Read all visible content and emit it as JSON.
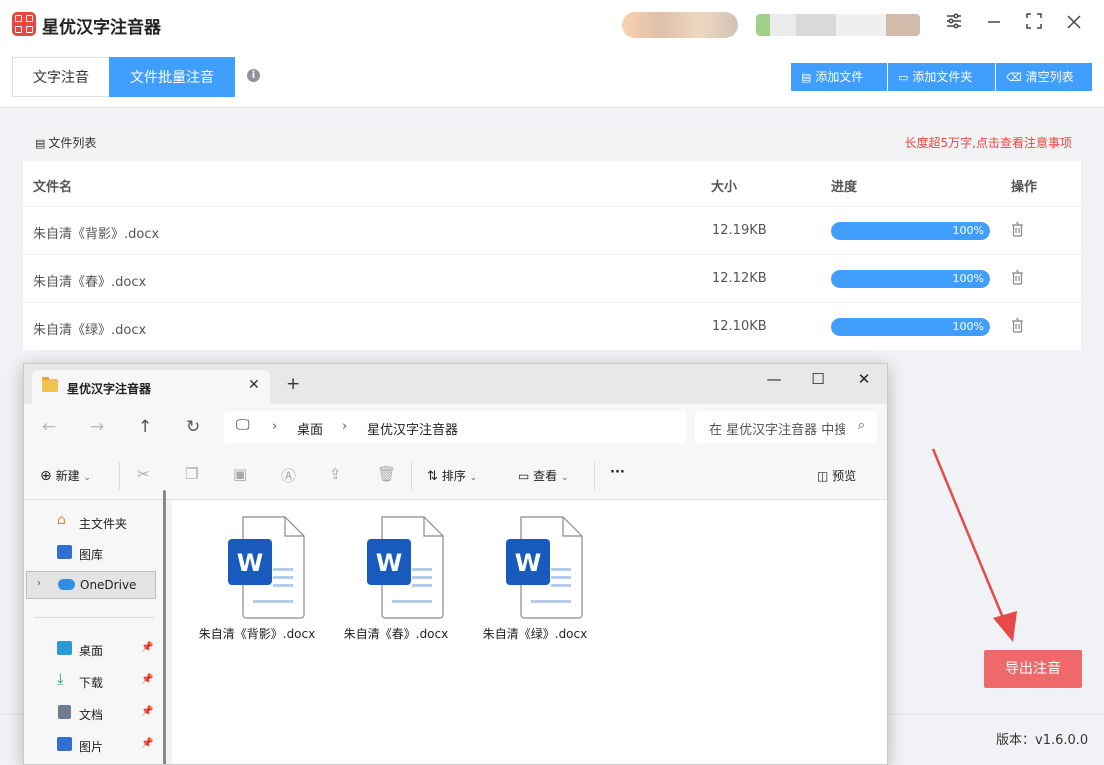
{
  "app": {
    "title": "星优汉字注音器",
    "version": "版本：v1.6.0.0",
    "accent": "#409eff",
    "export_color": "#f0696a"
  },
  "tabs": {
    "text_tab": "文字注音",
    "batch_tab": "文件批量注音"
  },
  "toolbar": {
    "add_file": "添加文件",
    "add_folder": "添加文件夹",
    "clear_list": "清空列表"
  },
  "file_list": {
    "title": "文件列表",
    "notice": "长度超5万字,点击查看注意事项",
    "headers": {
      "name": "文件名",
      "size": "大小",
      "progress": "进度",
      "action": "操作"
    },
    "rows": [
      {
        "name": "朱自清《背影》.docx",
        "size": "12.19KB",
        "progress": 1.0,
        "progress_label": "100%"
      },
      {
        "name": "朱自清《春》.docx",
        "size": "12.12KB",
        "progress": 1.0,
        "progress_label": "100%"
      },
      {
        "name": "朱自清《绿》.docx",
        "size": "12.10KB",
        "progress": 1.0,
        "progress_label": "100%"
      }
    ]
  },
  "export_button": "导出注音",
  "explorer": {
    "tab_title": "星优汉字注音器",
    "breadcrumb": [
      "桌面",
      "星优汉字注音器"
    ],
    "search_placeholder": "在 星优汉字注音器 中搜索",
    "toolbar": {
      "new": "新建",
      "sort": "排序",
      "view": "查看",
      "more": "···",
      "preview": "预览"
    },
    "sidebar": [
      {
        "label": "主文件夹",
        "icon": "home-icon"
      },
      {
        "label": "图库",
        "icon": "gallery-icon"
      },
      {
        "label": "OneDrive",
        "icon": "cloud-icon"
      },
      {
        "label": "桌面",
        "icon": "desktop-icon"
      },
      {
        "label": "下载",
        "icon": "download-icon"
      },
      {
        "label": "文档",
        "icon": "documents-icon"
      },
      {
        "label": "图片",
        "icon": "pictures-icon"
      }
    ],
    "files": [
      {
        "name": "朱自清《背影》.docx"
      },
      {
        "name": "朱自清《春》.docx"
      },
      {
        "name": "朱自清《绿》.docx"
      }
    ]
  }
}
